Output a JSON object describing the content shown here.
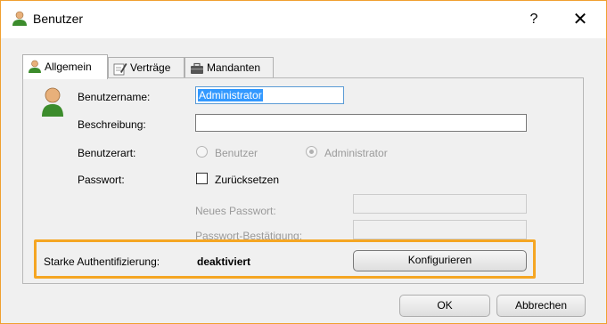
{
  "window": {
    "title": "Benutzer",
    "help_label": "?",
    "close_label": "✕",
    "accent_border": "#f0a030"
  },
  "tabs": [
    {
      "label": "Allgemein",
      "icon": "user-icon",
      "active": true
    },
    {
      "label": "Verträge",
      "icon": "contract-pen-icon",
      "active": false
    },
    {
      "label": "Mandanten",
      "icon": "briefcase-icon",
      "active": false
    }
  ],
  "form": {
    "username_label": "Benutzername:",
    "username_value": "Administrator",
    "description_label": "Beschreibung:",
    "description_value": "",
    "usertype_label": "Benutzerart:",
    "usertype_options": [
      "Benutzer",
      "Administrator"
    ],
    "password_label": "Passwort:",
    "reset_label": "Zurücksetzen",
    "new_password_label": "Neues Passwort:",
    "confirm_password_label": "Passwort-Bestätigung:",
    "strong_auth_label": "Starke Authentifizierung:",
    "strong_auth_status": "deaktiviert",
    "configure_label": "Konfigurieren"
  },
  "buttons": {
    "ok_label": "OK",
    "cancel_label": "Abbrechen"
  },
  "highlight_color": "#f5a623"
}
